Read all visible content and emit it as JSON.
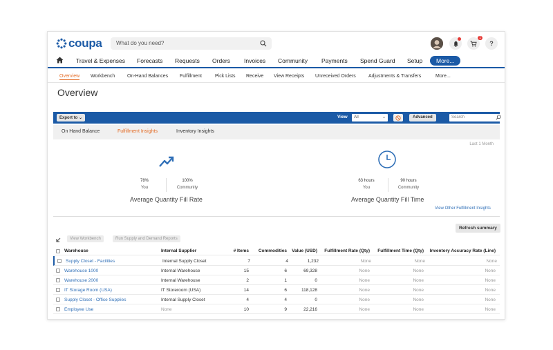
{
  "header": {
    "logo_text": "coupa",
    "search_placeholder": "What do you need?",
    "cart_count": "1",
    "help_label": "?"
  },
  "main_nav": {
    "items": [
      "Travel & Expenses",
      "Forecasts",
      "Requests",
      "Orders",
      "Invoices",
      "Community",
      "Payments",
      "Spend Guard",
      "Setup"
    ],
    "more_label": "More..."
  },
  "sub_nav": {
    "items": [
      "Overview",
      "Workbench",
      "On-Hand Balances",
      "Fulfillment",
      "Pick Lists",
      "Receive",
      "View Receipts",
      "Unreceived Orders",
      "Adjustments & Transfers",
      "More..."
    ],
    "active": "Overview"
  },
  "page_title": "Overview",
  "toolbar": {
    "export_label": "Export to",
    "view_label": "View",
    "view_value": "All",
    "advanced_label": "Advanced",
    "search_placeholder": "Search"
  },
  "insight_tabs": {
    "items": [
      "On Hand Balance",
      "Fulfillment Insights",
      "Inventory Insights"
    ],
    "active": "Fulfillment Insights"
  },
  "period_label": "Last 1 Month",
  "metrics": {
    "fill_rate": {
      "you_value": "78%",
      "you_label": "You",
      "community_value": "100%",
      "community_label": "Community",
      "title": "Average Quantity Fill Rate"
    },
    "fill_time": {
      "you_value": "63 hours",
      "you_label": "You",
      "community_value": "90 hours",
      "community_label": "Community",
      "title": "Average Quantity Fill Time"
    },
    "other_link": "View Other Fulfillment Insights"
  },
  "refresh_label": "Refresh summary",
  "table_actions": {
    "view_workbench": "View Workbench",
    "run_reports": "Run Supply and Demand Reports"
  },
  "table": {
    "headers": {
      "warehouse": "Warehouse",
      "supplier": "Internal Supplier",
      "items": "# Items",
      "commodities": "Commodities",
      "value": "Value (USD)",
      "fill_rate": "Fulfillment Rate (Qty)",
      "fill_time": "Fulfillment Time (Qty)",
      "accuracy": "Inventory Accuracy Rate (Line)"
    },
    "rows": [
      {
        "warehouse": "Supply Closet - Facilities",
        "supplier": "Internal Supply Closet",
        "items": "7",
        "commodities": "4",
        "value": "1,232",
        "fill_rate": "None",
        "fill_time": "None",
        "accuracy": "None"
      },
      {
        "warehouse": "Warehouse 1000",
        "supplier": "Internal Warehouse",
        "items": "15",
        "commodities": "6",
        "value": "69,328",
        "fill_rate": "None",
        "fill_time": "None",
        "accuracy": "None"
      },
      {
        "warehouse": "Warehouse 2000",
        "supplier": "Internal Warehouse",
        "items": "2",
        "commodities": "1",
        "value": "0",
        "fill_rate": "None",
        "fill_time": "None",
        "accuracy": "None"
      },
      {
        "warehouse": "IT Storage Room (USA)",
        "supplier": "IT Storeroom (USA)",
        "items": "14",
        "commodities": "6",
        "value": "118,128",
        "fill_rate": "None",
        "fill_time": "None",
        "accuracy": "None"
      },
      {
        "warehouse": "Supply Closet - Office Supplies",
        "supplier": "Internal Supply Closet",
        "items": "4",
        "commodities": "4",
        "value": "0",
        "fill_rate": "None",
        "fill_time": "None",
        "accuracy": "None"
      },
      {
        "warehouse": "Employee Use",
        "supplier": "None",
        "items": "10",
        "commodities": "9",
        "value": "22,216",
        "fill_rate": "None",
        "fill_time": "None",
        "accuracy": "None"
      }
    ]
  },
  "colors": {
    "brand_blue": "#1b5aa6",
    "accent_orange": "#e46b24",
    "link_blue": "#2f6fb7"
  }
}
